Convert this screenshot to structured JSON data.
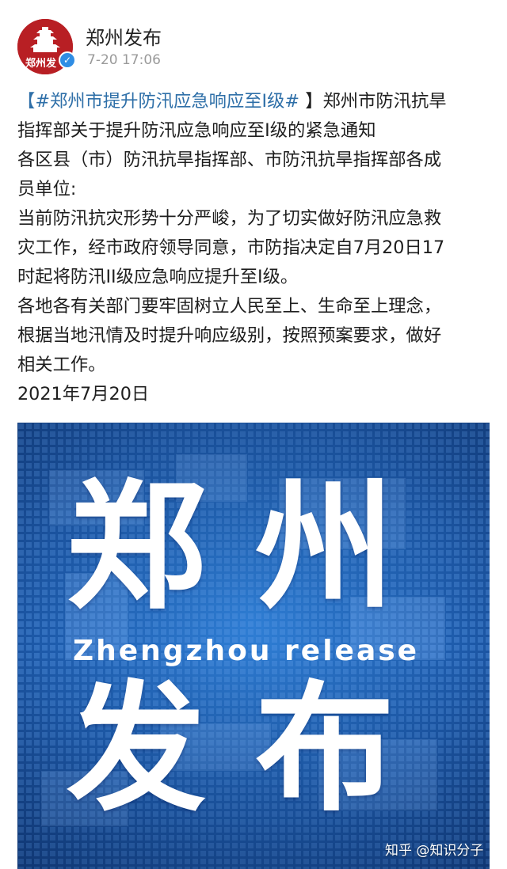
{
  "account": {
    "name": "郑州发布",
    "time": "7-20 17:06",
    "avatar_label": "郑州发"
  },
  "post": {
    "open_bracket": "【",
    "hashtag": "#郑州市提升防汛应急响应至I级#",
    "line1_rest": " 】郑州市防汛抗旱",
    "line2": "指挥部关于提升防汛应急响应至I级的紧急通知",
    "line3": "各区县（市）防汛抗旱指挥部、市防汛抗旱指挥部各成",
    "line4": "员单位:",
    "line5": "当前防汛抗灾形势十分严峻，为了切实做好防汛应急救",
    "line6": "灾工作，经市政府领导同意，市防指决定自7月20日17",
    "line7": "时起将防汛II级应急响应提升至I级。",
    "line8": "各地各有关部门要牢固树立人民至上、生命至上理念，",
    "line9": "根据当地汛情及时提升响应级别，按照预案要求，做好",
    "line10": "相关工作。",
    "line11": "2021年7月20日"
  },
  "image": {
    "char1": "郑",
    "char2": "州",
    "char3": "发",
    "char4": "布",
    "english": "Zhengzhou release",
    "bg_color": "#1f5fb0"
  },
  "watermark": "知乎 @知识分子"
}
